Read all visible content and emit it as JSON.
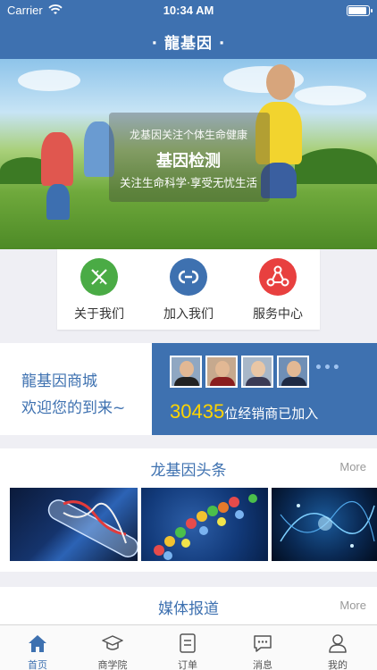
{
  "status": {
    "carrier": "Carrier",
    "time": "10:34 AM"
  },
  "nav": {
    "title": "· 龍基因 ·"
  },
  "banner": {
    "line1": "龙基因关注个体生命健康",
    "line2": "基因检测",
    "line3": "关注生命科学·享受无忧生活"
  },
  "quick": [
    {
      "label": "关于我们",
      "icon": "dna-icon",
      "color": "#4aab45"
    },
    {
      "label": "加入我们",
      "icon": "link-icon",
      "color": "#3e71b0"
    },
    {
      "label": "服务中心",
      "icon": "share-icon",
      "color": "#e8403f"
    }
  ],
  "mall": {
    "line1": "龍基因商城",
    "line2": "欢迎您的到来~",
    "count": "30435",
    "count_suffix": "位经销商已加入",
    "more_dots": "•••"
  },
  "headlines": {
    "title": "龙基因头条",
    "more": "More"
  },
  "media": {
    "title": "媒体报道",
    "more": "More"
  },
  "tabs": [
    {
      "label": "首页",
      "icon": "home-icon",
      "active": true
    },
    {
      "label": "商学院",
      "icon": "graduation-cap-icon",
      "active": false
    },
    {
      "label": "订单",
      "icon": "order-list-icon",
      "active": false
    },
    {
      "label": "消息",
      "icon": "message-icon",
      "active": false
    },
    {
      "label": "我的",
      "icon": "user-icon",
      "active": false
    }
  ],
  "colors": {
    "brand": "#3e71b0",
    "accent_yellow": "#ffd400"
  }
}
